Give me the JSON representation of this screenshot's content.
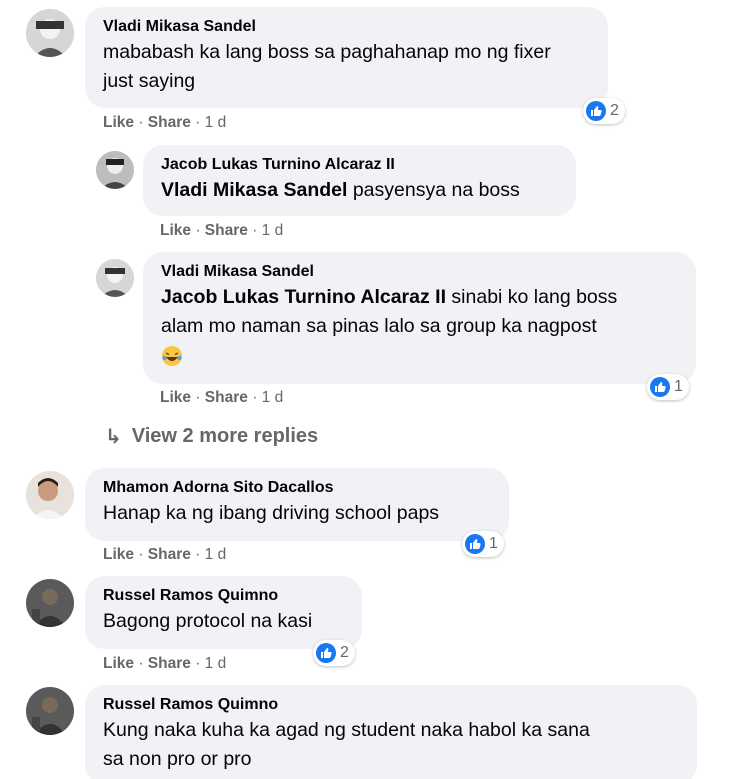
{
  "comments": [
    {
      "author": "Vladi Mikasa Sandel",
      "text_lines": [
        "mababash ka lang boss sa paghahanap mo ng fixer",
        "just saying"
      ],
      "actions": {
        "like": "Like",
        "share": "Share",
        "time": "1 d"
      },
      "reactions": "2"
    },
    {
      "author": "Jacob Lukas Turnino Alcaraz II",
      "mention": "Vladi Mikasa Sandel",
      "text": " pasyensya na boss",
      "actions": {
        "like": "Like",
        "share": "Share",
        "time": "1 d"
      }
    },
    {
      "author": "Vladi Mikasa Sandel",
      "mention": "Jacob Lukas Turnino Alcaraz II",
      "text_line1": " sinabi ko lang boss",
      "text_line2": "alam mo naman sa pinas lalo sa group ka nagpost",
      "emoji": "laughing-tears",
      "actions": {
        "like": "Like",
        "share": "Share",
        "time": "1 d"
      },
      "reactions": "1"
    },
    {
      "author": "Mhamon Adorna Sito Dacallos",
      "text": "Hanap ka ng ibang driving school paps",
      "actions": {
        "like": "Like",
        "share": "Share",
        "time": "1 d"
      },
      "reactions": "1"
    },
    {
      "author": "Russel Ramos Quimno",
      "text": "Bagong protocol na kasi",
      "actions": {
        "like": "Like",
        "share": "Share",
        "time": "1 d"
      },
      "reactions": "2"
    },
    {
      "author": "Russel Ramos Quimno",
      "text_lines": [
        "Kung naka kuha ka agad ng student naka habol ka sana",
        "sa non pro or pro"
      ]
    }
  ],
  "view_more": "View 2 more replies",
  "separator": " · ",
  "colors": {
    "bubble": "#f0f2f5",
    "meta": "#65676b",
    "like_blue": "#1877f2"
  }
}
